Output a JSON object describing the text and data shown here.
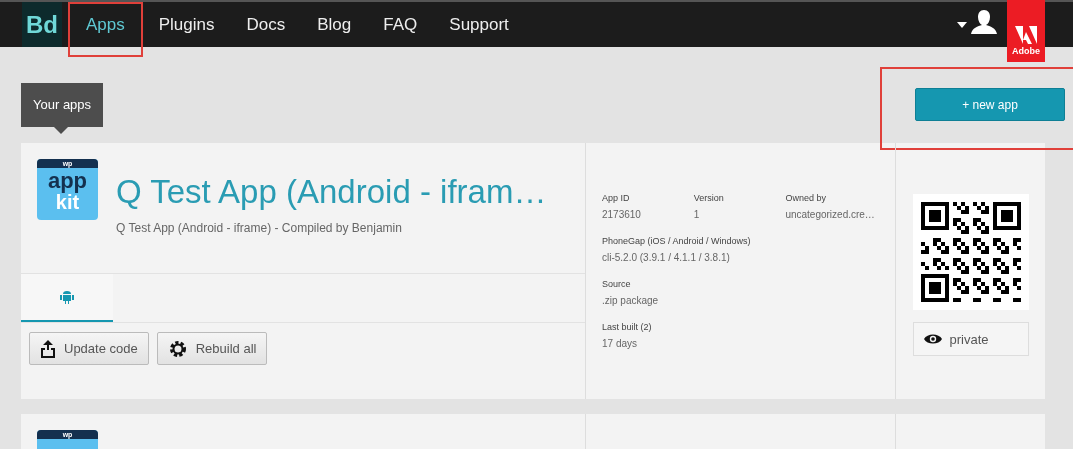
{
  "nav": {
    "logo": "Bd",
    "items": [
      {
        "label": "Apps",
        "selected": true,
        "annotated": true
      },
      {
        "label": "Plugins",
        "selected": false,
        "annotated": false
      },
      {
        "label": "Docs",
        "selected": false,
        "annotated": false
      },
      {
        "label": "Blog",
        "selected": false,
        "annotated": false
      },
      {
        "label": "FAQ",
        "selected": false,
        "annotated": false
      },
      {
        "label": "Support",
        "selected": false,
        "annotated": false
      }
    ],
    "brand": "Adobe"
  },
  "section_tab": "Your apps",
  "new_app_button": {
    "label": "+ new app",
    "annotated": true
  },
  "apps": [
    {
      "icon_text": [
        "wp",
        "app",
        "kit"
      ],
      "title": "Q Test App (Android - ifram…",
      "subtitle": "Q Test App (Android - iframe) - Compiled by Benjamin",
      "platform_tabs": [
        {
          "kind": "android",
          "selected": true
        }
      ],
      "buttons": [
        {
          "kind": "upload",
          "label": "Update code"
        },
        {
          "kind": "rebuild",
          "label": "Rebuild all"
        }
      ],
      "details": [
        {
          "label": "App ID",
          "value": "2173610"
        },
        {
          "label": "Version",
          "value": "1"
        },
        {
          "label": "Owned by",
          "value": "uncategorized.cre…"
        }
      ],
      "details_full": [
        {
          "label": "PhoneGap (iOS / Android / Windows)",
          "value": "cli-5.2.0 (3.9.1 / 4.1.1 / 3.8.1)"
        },
        {
          "label": "Source",
          "value": ".zip package"
        },
        {
          "label": "Last built (2)",
          "value": "17 days"
        }
      ],
      "privacy": "private"
    },
    {
      "icon_text": [
        "wp"
      ]
    }
  ]
}
